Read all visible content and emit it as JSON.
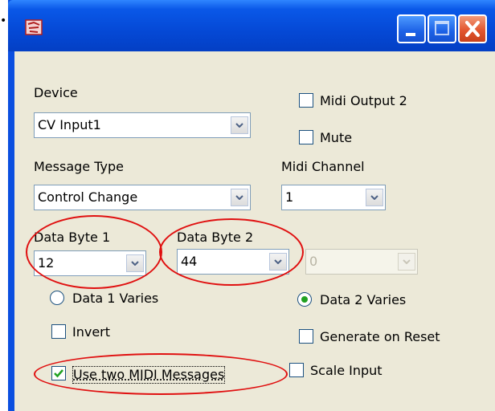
{
  "window": {
    "title": "",
    "controls": [
      "minimize",
      "maximize",
      "close"
    ]
  },
  "labels": {
    "device": "Device",
    "message_type": "Message Type",
    "midi_channel": "Midi Channel",
    "data_byte_1": "Data Byte 1",
    "data_byte_2": "Data Byte 2"
  },
  "combos": {
    "device": "CV Input1",
    "message_type": "Control Change",
    "midi_channel": "1",
    "data_byte_1": "12",
    "data_byte_2": "44",
    "data_byte_3_disabled": "0"
  },
  "checkboxes": {
    "midi_output_2": {
      "label": "Midi Output 2",
      "checked": false
    },
    "mute": {
      "label": "Mute",
      "checked": false
    },
    "invert": {
      "label": "Invert",
      "checked": false
    },
    "generate_on_reset": {
      "label": "Generate on Reset",
      "checked": false
    },
    "use_two_midi_messages": {
      "label": "Use two MIDI Messages",
      "checked": true
    },
    "scale_input": {
      "label": "Scale Input",
      "checked": false
    }
  },
  "radios": {
    "data_1_varies": {
      "label": "Data 1 Varies",
      "selected": false
    },
    "data_2_varies": {
      "label": "Data 2 Varies",
      "selected": true
    }
  },
  "annotation_color": "#e01010",
  "icons": {
    "app_icon": "app-icon",
    "combo_arrow": "chevron-down-icon",
    "check": "check-icon"
  }
}
